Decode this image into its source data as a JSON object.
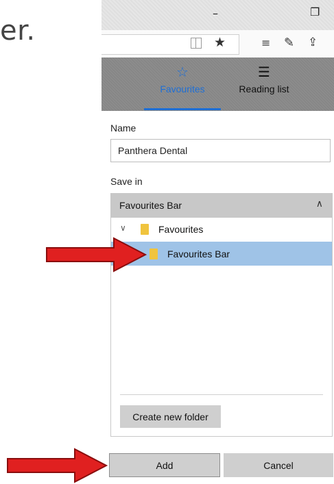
{
  "caption_fragment": "er.",
  "window": {
    "minimize_glyph": "–",
    "restore_glyph": "❐"
  },
  "toolbar": {
    "reading_view_icon": "reading-view-icon",
    "favorite_icon": "★",
    "hub_icon": "≡",
    "notes_icon": "✎",
    "share_icon": "⇪"
  },
  "hub": {
    "tabs": [
      {
        "label": "Favourites",
        "icon": "☆",
        "active": true
      },
      {
        "label": "Reading list",
        "icon": "☰",
        "active": false
      }
    ],
    "accent": "#1e6fd6"
  },
  "form": {
    "name_label": "Name",
    "name_value": "Panthera Dental",
    "save_in_label": "Save in",
    "dropdown_value": "Favourites Bar",
    "dropdown_chevron": "∧",
    "tree": {
      "root": {
        "label": "Favourites",
        "expander": "∨"
      },
      "child": {
        "label": "Favourites Bar",
        "selected": true
      }
    },
    "create_folder_label": "Create new folder",
    "add_label": "Add",
    "cancel_label": "Cancel"
  },
  "colors": {
    "selection": "#9fc3e7",
    "folder": "#f0c43e",
    "arrow": "#e02020"
  }
}
